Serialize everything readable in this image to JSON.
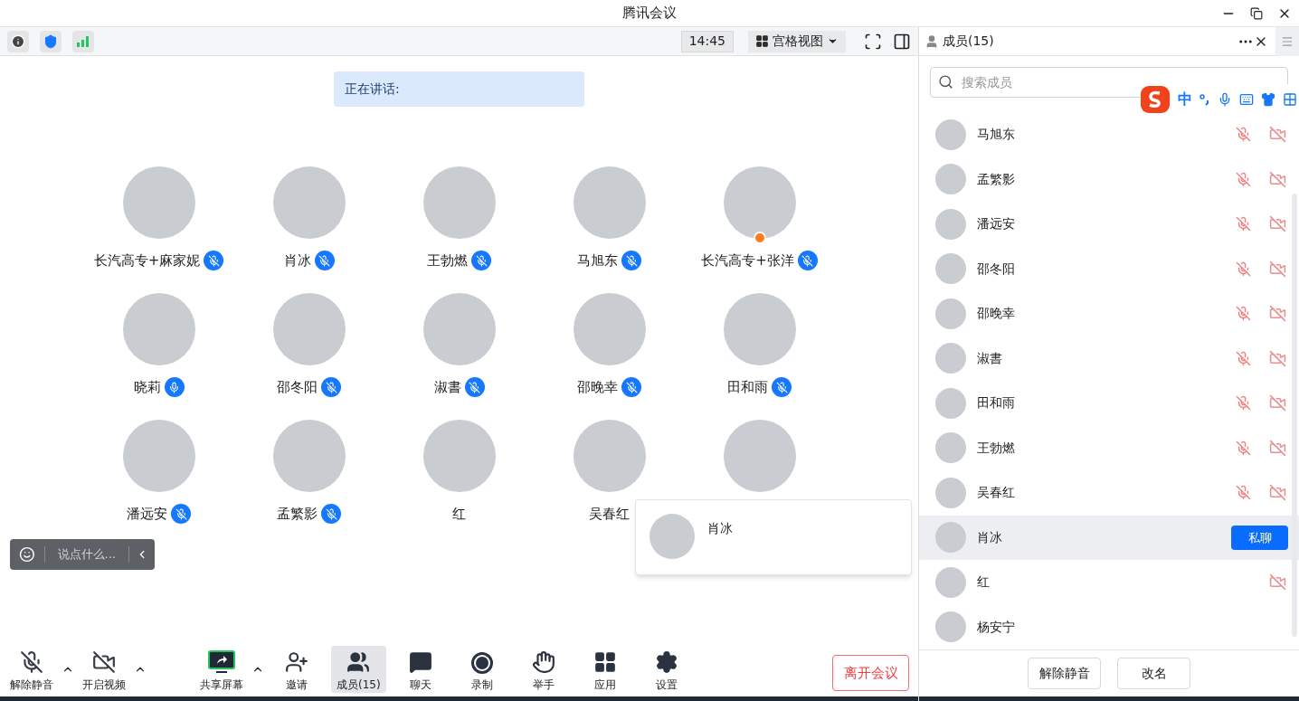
{
  "window": {
    "title": "腾讯会议"
  },
  "top_bar": {
    "time": "14:45",
    "view_menu": "宫格视图"
  },
  "speaking_banner": "正在讲话:",
  "participants": [
    {
      "name": "长汽高专+麻家妮",
      "mic_icon": true,
      "muted": true,
      "host": false
    },
    {
      "name": "肖冰",
      "mic_icon": true,
      "muted": true,
      "host": false
    },
    {
      "name": "王勃燃",
      "mic_icon": true,
      "muted": true,
      "host": false
    },
    {
      "name": "马旭东",
      "mic_icon": true,
      "muted": true,
      "host": false
    },
    {
      "name": "长汽高专+张洋",
      "mic_icon": true,
      "muted": true,
      "host": true
    },
    {
      "name": "晓莉",
      "mic_icon": true,
      "muted": false,
      "host": false
    },
    {
      "name": "邵冬阳",
      "mic_icon": true,
      "muted": true,
      "host": false
    },
    {
      "name": "淑書",
      "mic_icon": true,
      "muted": true,
      "host": false
    },
    {
      "name": "邵晚幸",
      "mic_icon": true,
      "muted": true,
      "host": false
    },
    {
      "name": "田和雨",
      "mic_icon": true,
      "muted": true,
      "host": false
    },
    {
      "name": "潘远安",
      "mic_icon": true,
      "muted": true,
      "host": false
    },
    {
      "name": "孟繁影",
      "mic_icon": true,
      "muted": true,
      "host": false
    },
    {
      "name": "红",
      "mic_icon": false,
      "host": false
    },
    {
      "name": "吴春红",
      "mic_icon": false,
      "host": false
    },
    {
      "mic_icon": false,
      "host": false
    }
  ],
  "chat_input": {
    "placeholder": "说点什么..."
  },
  "hover_card": {
    "name": "肖冰"
  },
  "toolbar": {
    "items": [
      {
        "label": "解除静音",
        "kind": "mic",
        "menu": true,
        "selected": false
      },
      {
        "label": "开启视频",
        "kind": "video",
        "menu": true,
        "selected": false
      },
      {
        "label": "共享屏幕",
        "kind": "share",
        "menu": true,
        "selected": false
      },
      {
        "label": "邀请",
        "kind": "invite",
        "menu": false,
        "selected": false
      },
      {
        "label": "成员(15)",
        "kind": "members",
        "menu": false,
        "selected": true
      },
      {
        "label": "聊天",
        "kind": "chat",
        "menu": false,
        "selected": false
      },
      {
        "label": "录制",
        "kind": "record",
        "menu": false,
        "selected": false
      },
      {
        "label": "举手",
        "kind": "hand",
        "menu": false,
        "selected": false
      },
      {
        "label": "应用",
        "kind": "apps",
        "menu": false,
        "selected": false
      },
      {
        "label": "设置",
        "kind": "settings",
        "menu": false,
        "selected": false
      }
    ],
    "leave_button": "离开会议"
  },
  "members_panel": {
    "title": "成员(15)",
    "search": {
      "placeholder": "搜索成员"
    },
    "members": [
      {
        "name": "马旭东",
        "mic_muted": true,
        "video_off": true,
        "selected": false
      },
      {
        "name": "孟繁影",
        "mic_muted": true,
        "video_off": true,
        "selected": false
      },
      {
        "name": "潘远安",
        "mic_muted": true,
        "video_off": true,
        "selected": false
      },
      {
        "name": "邵冬阳",
        "mic_muted": true,
        "video_off": true,
        "selected": false
      },
      {
        "name": "邵晚幸",
        "mic_muted": true,
        "video_off": true,
        "selected": false
      },
      {
        "name": "淑書",
        "mic_muted": true,
        "video_off": true,
        "selected": false
      },
      {
        "name": "田和雨",
        "mic_muted": true,
        "video_off": true,
        "selected": false
      },
      {
        "name": "王勃燃",
        "mic_muted": true,
        "video_off": true,
        "selected": false
      },
      {
        "name": "吴春红",
        "mic_muted": true,
        "video_off": true,
        "selected": false
      },
      {
        "name": "肖冰",
        "mic_muted": false,
        "video_off": false,
        "selected": true,
        "chat_button": "私聊"
      },
      {
        "name": "红",
        "mic_muted": false,
        "video_off": true,
        "selected": false
      },
      {
        "name": "杨安宁",
        "mic_muted": false,
        "video_off": false,
        "selected": false
      }
    ],
    "buttons": [
      "解除静音",
      "改名"
    ]
  },
  "ime_bar": {
    "mode": "中"
  }
}
